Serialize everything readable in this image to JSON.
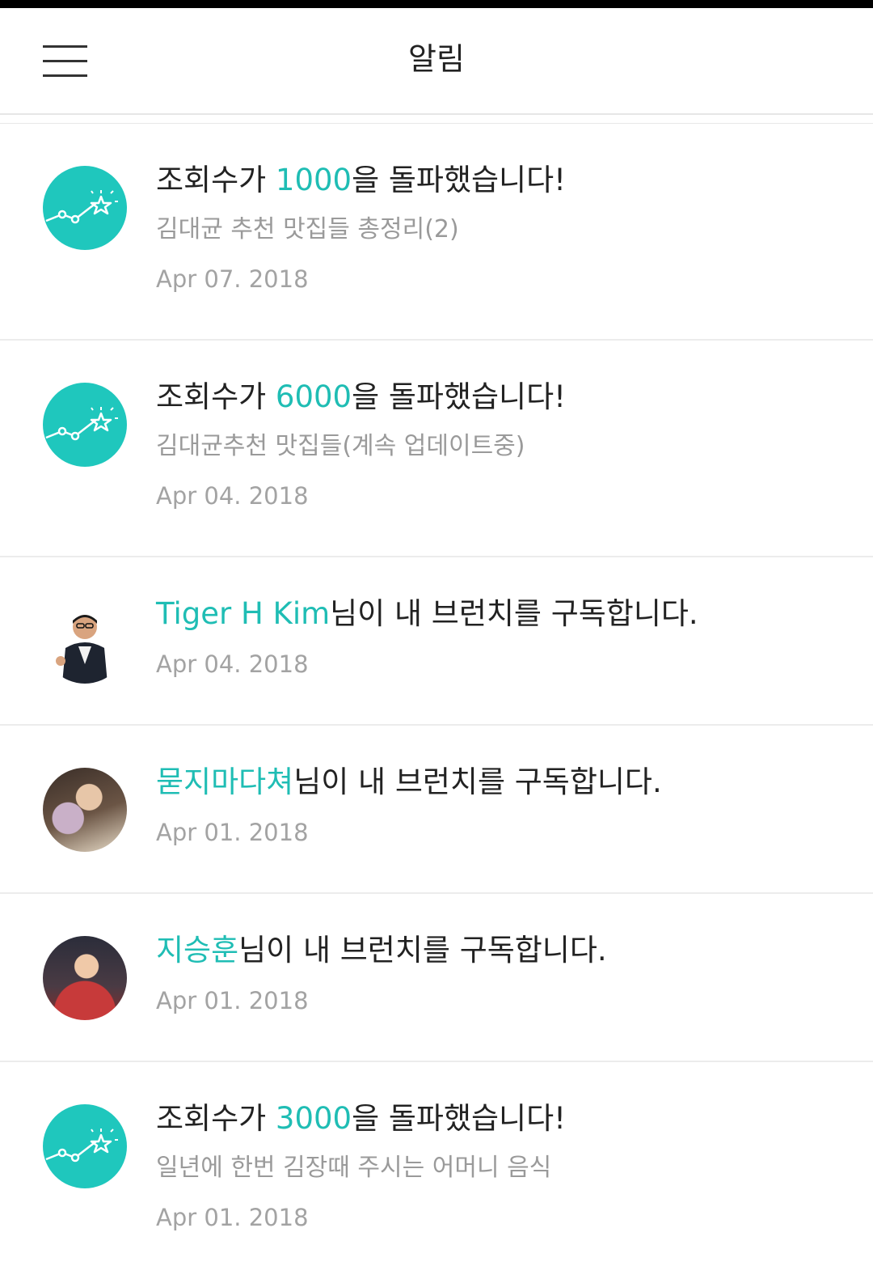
{
  "header": {
    "title": "알림",
    "menu_icon": "hamburger-menu-icon"
  },
  "colors": {
    "accent": "#1fbdb4",
    "badge": "#1fc7bd",
    "text_primary": "#222222",
    "text_secondary": "#9a9a9a"
  },
  "notifications": [
    {
      "icon": "views-milestone-icon",
      "prefix": "조회수가 ",
      "highlight": "1000",
      "suffix": "을 돌파했습니다!",
      "subtitle": "김대균 추천 맛집들 총정리(2)",
      "date": "Apr 07. 2018"
    },
    {
      "icon": "views-milestone-icon",
      "prefix": "조회수가 ",
      "highlight": "6000",
      "suffix": "을 돌파했습니다!",
      "subtitle": "김대균추천 맛집들(계속 업데이트중)",
      "date": "Apr 04. 2018"
    },
    {
      "icon": "user-avatar",
      "prefix": "",
      "highlight": "Tiger H Kim",
      "suffix": "님이 내 브런치를 구독합니다.",
      "date": "Apr 04. 2018"
    },
    {
      "icon": "user-avatar",
      "prefix": "",
      "highlight": "묻지마다쳐",
      "suffix": "님이 내 브런치를 구독합니다.",
      "date": "Apr 01. 2018"
    },
    {
      "icon": "user-avatar",
      "prefix": "",
      "highlight": "지승훈",
      "suffix": "님이 내 브런치를 구독합니다.",
      "date": "Apr 01. 2018"
    },
    {
      "icon": "views-milestone-icon",
      "prefix": "조회수가 ",
      "highlight": "3000",
      "suffix": "을 돌파했습니다!",
      "subtitle": "일년에 한번 김장때 주시는 어머니 음식",
      "date": "Apr 01. 2018"
    }
  ]
}
